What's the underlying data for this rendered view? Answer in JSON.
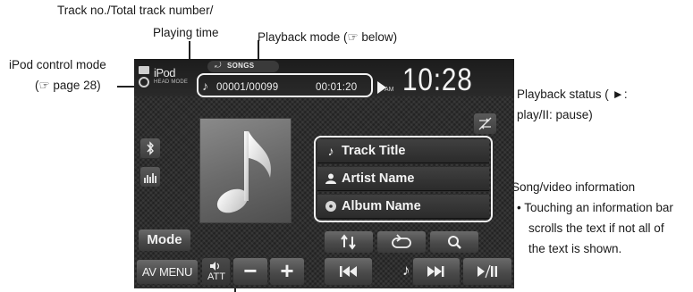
{
  "annotations": {
    "track_info_line1": "Track no./Total track number/",
    "track_info_line2": "Playing time",
    "playback_mode": "Playback mode (☞ below)",
    "ipod_mode_line1": "iPod control mode",
    "ipod_mode_line2": "(☞ page 28)",
    "playback_status_line1": "Playback status ( ►:",
    "playback_status_line2": "play/II: pause)",
    "song_info": "Song/video information",
    "song_info_note_1": "•  Touching an information bar",
    "song_info_note_2": "scrolls the text if not all of",
    "song_info_note_3": "the text is shown."
  },
  "screen": {
    "source_label": "iPod",
    "source_sub": "HEAD MODE",
    "playback_mode_label": "SONGS",
    "track_number": "00001/00099",
    "playing_time": "00:01:20",
    "am_pm": "AM",
    "clock": "10:28",
    "info": [
      {
        "icon": "music-note-icon",
        "text": "Track Title"
      },
      {
        "icon": "person-icon",
        "text": "Artist Name"
      },
      {
        "icon": "disc-icon",
        "text": "Album Name"
      }
    ],
    "buttons": {
      "mode": "Mode",
      "av_menu": "AV MENU",
      "att": "ATT",
      "vol_down": "−",
      "vol_up": "+"
    }
  },
  "colors": {
    "screen_bg": "#2e2e2e",
    "highlight": "#f2f2f2",
    "annotation_text": "#1a1a1a"
  }
}
